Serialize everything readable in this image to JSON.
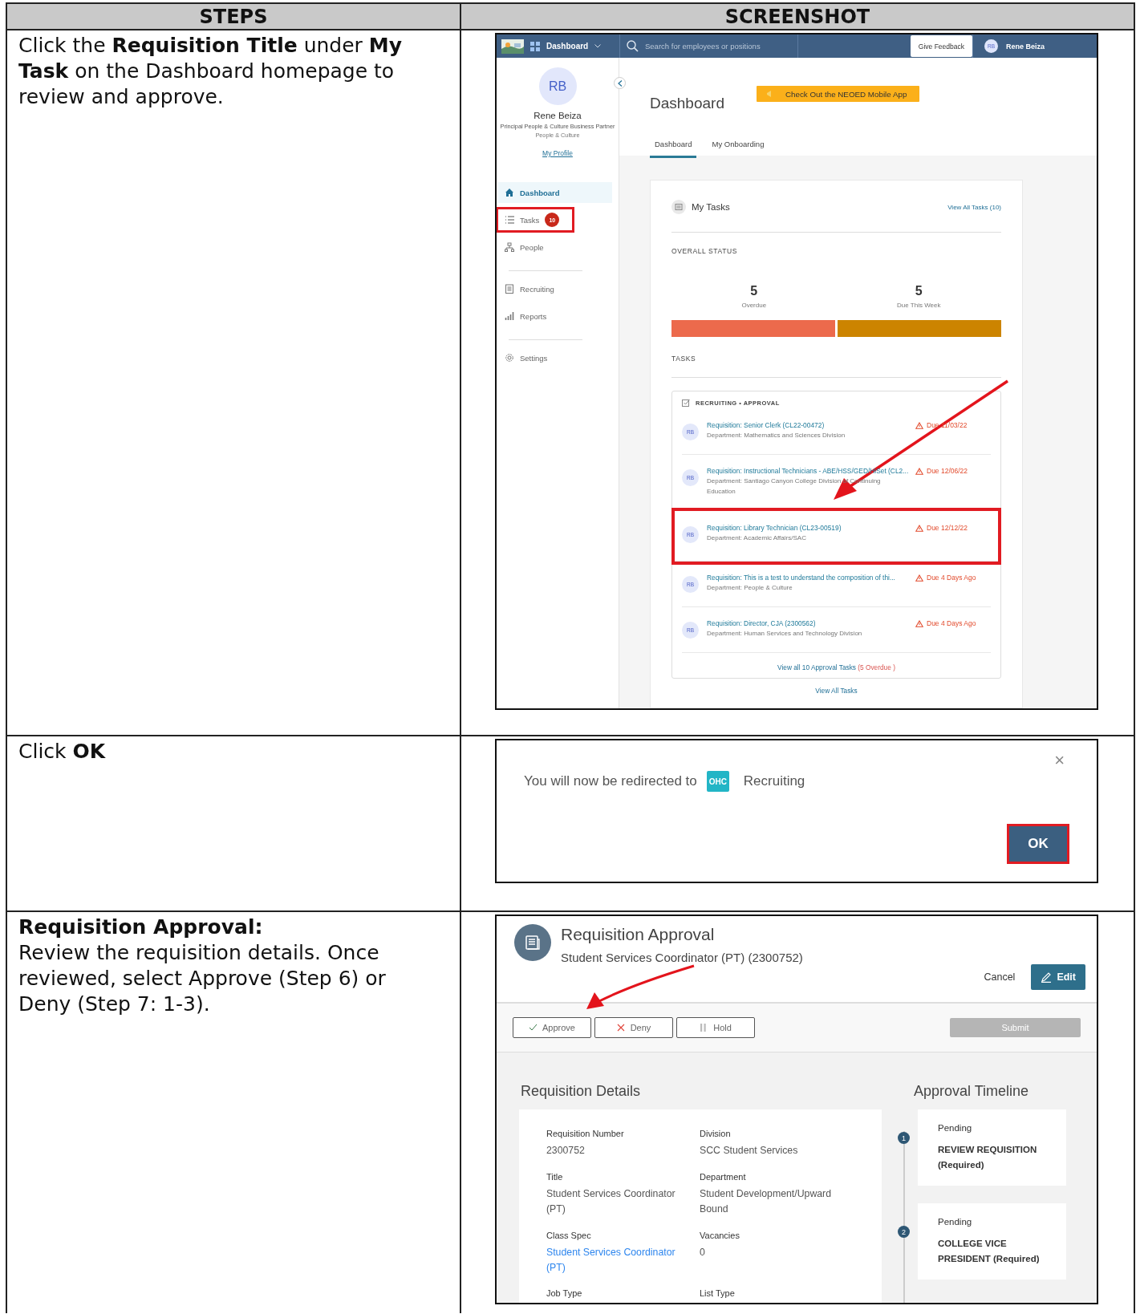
{
  "table": {
    "columns": [
      "STEPS",
      "SCREENSHOT"
    ]
  },
  "steps": [
    {
      "kind": "dashboard",
      "instruction": "Click the **Requisition Title** under **My Task** on the Dashboard homepage to review and approve.",
      "screen": {
        "topbar": {
          "menu": "Dashboard",
          "search_placeholder": "Search for employees or positions",
          "feedback": "Give Feedback",
          "user_initials": "RB",
          "user_name": "Rene Beiza"
        },
        "profile": {
          "initials": "RB",
          "name": "Rene Beiza",
          "role": "Principal People & Culture Business Partner",
          "department": "People & Culture",
          "link": "My Profile"
        },
        "nav_groups": [
          {
            "items": [
              {
                "kind": "home",
                "label": "Dashboard",
                "selected": true,
                "highlighted": false
              },
              {
                "kind": "tasks",
                "label": "Tasks",
                "badge": "10",
                "selected": false,
                "highlighted": true
              },
              {
                "kind": "people",
                "label": "People",
                "selected": false,
                "highlighted": false
              }
            ]
          },
          {
            "items": [
              {
                "kind": "recruiting",
                "label": "Recruiting",
                "selected": false,
                "highlighted": false
              },
              {
                "kind": "reports",
                "label": "Reports",
                "selected": false,
                "highlighted": false
              }
            ]
          },
          {
            "items": [
              {
                "kind": "settings",
                "label": "Settings",
                "selected": false,
                "highlighted": false
              }
            ]
          }
        ],
        "title": "Dashboard",
        "banner": "Check Out the NEOED Mobile App",
        "tabs": [
          {
            "label": "Dashboard",
            "selected": true
          },
          {
            "label": "My Onboarding",
            "selected": false
          }
        ],
        "card": {
          "title": "My Tasks",
          "link": "View All Tasks (10)",
          "status_heading": "OVERALL STATUS",
          "stats": [
            {
              "value": "5",
              "label": "Overdue",
              "color": "#ec6a4c"
            },
            {
              "value": "5",
              "label": "Due This Week",
              "color": "#cc8400"
            }
          ],
          "tasks_heading": "TASKS",
          "group": {
            "heading": "RECRUITING • APPROVAL",
            "rows": [
              {
                "initials": "RB",
                "title": "Requisition: Senior Clerk (CL22-00472)",
                "department": "Department: Mathematics and Sciences Division",
                "due": "Due 11/03/22",
                "highlighted": false
              },
              {
                "initials": "RB",
                "title": "Requisition: Instructional Technicians - ABE/HSS/GED/HiSet (CL2...",
                "department": "Department: Santiago Canyon College Division of Continuing Education",
                "due": "Due 12/06/22",
                "highlighted": false
              },
              {
                "initials": "RB",
                "title": "Requisition: Library Technician (CL23-00519)",
                "department": "Department: Academic Affairs/SAC",
                "due": "Due 12/12/22",
                "highlighted": true
              },
              {
                "initials": "RB",
                "title": "Requisition: This is a test to understand the composition of thi...",
                "department": "Department: People & Culture",
                "due": "Due 4 Days Ago",
                "highlighted": false
              },
              {
                "initials": "RB",
                "title": "Requisition: Director, CJA (2300562)",
                "department": "Department: Human Services and Technology Division",
                "due": "Due 4 Days Ago",
                "highlighted": false
              }
            ],
            "footer_link": "View all 10 Approval Tasks",
            "footer_overdue": "(5 Overdue )"
          },
          "bottom_link": "View All Tasks"
        }
      }
    },
    {
      "kind": "dialog",
      "instruction": "Click **OK**",
      "screen": {
        "message": "You will now be redirected to",
        "app_logo": "OHC",
        "app_name": "Recruiting",
        "close": "×",
        "ok": {
          "label": "OK",
          "highlighted": true
        }
      }
    },
    {
      "kind": "requisition",
      "title": "Requisition Approval:",
      "instruction": "Review the requisition details. Once reviewed, select Approve (Step 6) or Deny (Step 7: 1-3).",
      "screen": {
        "title": "Requisition Approval",
        "subtitle": "Student Services Coordinator (PT) (2300752)",
        "cancel": "Cancel",
        "edit": "Edit",
        "actions": [
          {
            "kind": "approve",
            "label": "Approve"
          },
          {
            "kind": "deny",
            "label": "Deny"
          },
          {
            "kind": "hold",
            "label": "Hold"
          }
        ],
        "submit": {
          "label": "Submit",
          "disabled": true
        },
        "details_heading": "Requisition Details",
        "fields": [
          {
            "kind": "text",
            "label": "Requisition Number",
            "value": "2300752"
          },
          {
            "kind": "text",
            "label": "Division",
            "value": "SCC Student Services"
          },
          {
            "kind": "text",
            "label": "Title",
            "value": "Student Services Coordinator (PT)"
          },
          {
            "kind": "text",
            "label": "Department",
            "value": "Student Development/Upward Bound"
          },
          {
            "kind": "link",
            "label": "Class Spec",
            "value": "Student Services Coordinator (PT)"
          },
          {
            "kind": "text",
            "label": "Vacancies",
            "value": "0"
          },
          {
            "kind": "text",
            "label": "Job Type"
          },
          {
            "kind": "text",
            "label": "List Type"
          }
        ],
        "timeline_heading": "Approval Timeline",
        "timeline": [
          {
            "number": "1",
            "status": "Pending",
            "step": "REVIEW REQUISITION (Required)"
          },
          {
            "number": "2",
            "status": "Pending",
            "step": "COLLEGE VICE PRESIDENT (Required)"
          }
        ]
      }
    }
  ]
}
